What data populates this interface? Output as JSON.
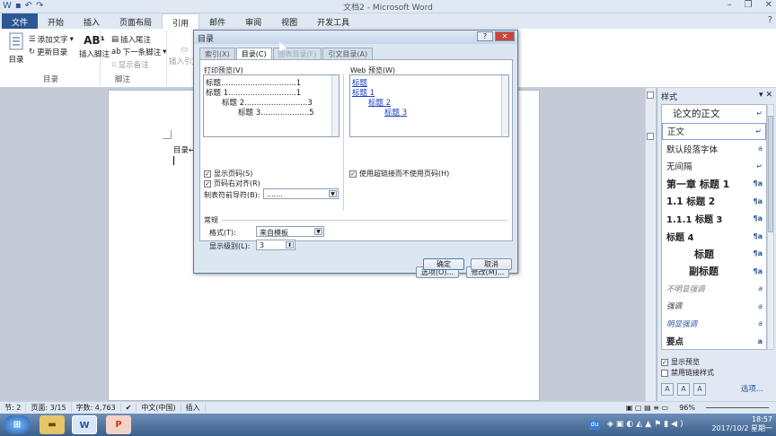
{
  "window": {
    "title": "文档2 - Microsoft Word"
  },
  "tabs": [
    "文件",
    "开始",
    "插入",
    "页面布局",
    "引用",
    "邮件",
    "审阅",
    "视图",
    "开发工具"
  ],
  "ribbon": {
    "toc_btn": "目录",
    "add_text": "添加文字",
    "update_toc": "更新目录",
    "group_toc": "目录",
    "insert_footnote": "插入脚注",
    "insert_endnote": "插入尾注",
    "next_footnote": "下一条脚注",
    "show_notes": "显示备注",
    "group_footnote": "脚注",
    "insert_citation": "插入引文"
  },
  "document": {
    "toc_text": "目录↵"
  },
  "dialog": {
    "title": "目录",
    "help": "?",
    "tabs": [
      "索引(X)",
      "目录(C)",
      "图表目录(F)",
      "引文目录(A)"
    ],
    "print_preview_label": "打印预览(V)",
    "print_preview": [
      {
        "text": "标题",
        "page": "1"
      },
      {
        "text": "标题 1",
        "page": "1"
      },
      {
        "text": "标题 2",
        "page": "3"
      },
      {
        "text": "标题 3",
        "page": "5"
      }
    ],
    "web_preview_label": "Web 预览(W)",
    "web_preview": [
      "标题",
      "标题 1",
      "标题 2",
      "标题 3"
    ],
    "show_page_numbers": "显示页码(S)",
    "right_align": "页码右对齐(R)",
    "tab_leader_label": "制表符前导符(B):",
    "tab_leader_value": ".......",
    "use_hyperlinks": "使用超链接而不使用页码(H)",
    "general_label": "常规",
    "format_label": "格式(T):",
    "format_value": "来自模板",
    "levels_label": "显示级别(L):",
    "levels_value": "3",
    "options_btn": "选项(O)...",
    "modify_btn": "修改(M)...",
    "ok_btn": "确定",
    "cancel_btn": "取消"
  },
  "stylepane": {
    "title": "样式",
    "items": [
      {
        "name": "论文的正文",
        "mark": "↵",
        "cls": "first"
      },
      {
        "name": "正文",
        "mark": "↵",
        "cls": "sel"
      },
      {
        "name": "默认段落字体",
        "mark": "a",
        "cls": ""
      },
      {
        "name": "无间隔",
        "mark": "↵",
        "cls": ""
      },
      {
        "name": "第一章 标题 1",
        "mark": "¶a",
        "cls": "h1"
      },
      {
        "name": "1.1 标题 2",
        "mark": "¶a",
        "cls": "h2"
      },
      {
        "name": "1.1.1 标题 3",
        "mark": "¶a",
        "cls": "h3"
      },
      {
        "name": "标题 4",
        "mark": "¶a",
        "cls": "h4"
      },
      {
        "name": "标题",
        "mark": "¶a",
        "cls": "cen"
      },
      {
        "name": "副标题",
        "mark": "¶a",
        "cls": "sub"
      },
      {
        "name": "不明显强调",
        "mark": "a",
        "cls": "em1"
      },
      {
        "name": "强调",
        "mark": "a",
        "cls": "em2"
      },
      {
        "name": "明显强调",
        "mark": "a",
        "cls": "em3"
      },
      {
        "name": "要点",
        "mark": "a",
        "cls": "strong"
      }
    ],
    "show_preview": "显示预览",
    "disable_linked": "禁用链接样式",
    "options": "选项..."
  },
  "status": {
    "section": "节: 2",
    "page": "页面: 3/15",
    "words": "字数: 4,763",
    "lang": "中文(中国)",
    "mode": "插入",
    "zoom": "96%"
  },
  "tray": {
    "time": "18:57",
    "date": "2017/10/2 星期一",
    "ime": "du"
  }
}
